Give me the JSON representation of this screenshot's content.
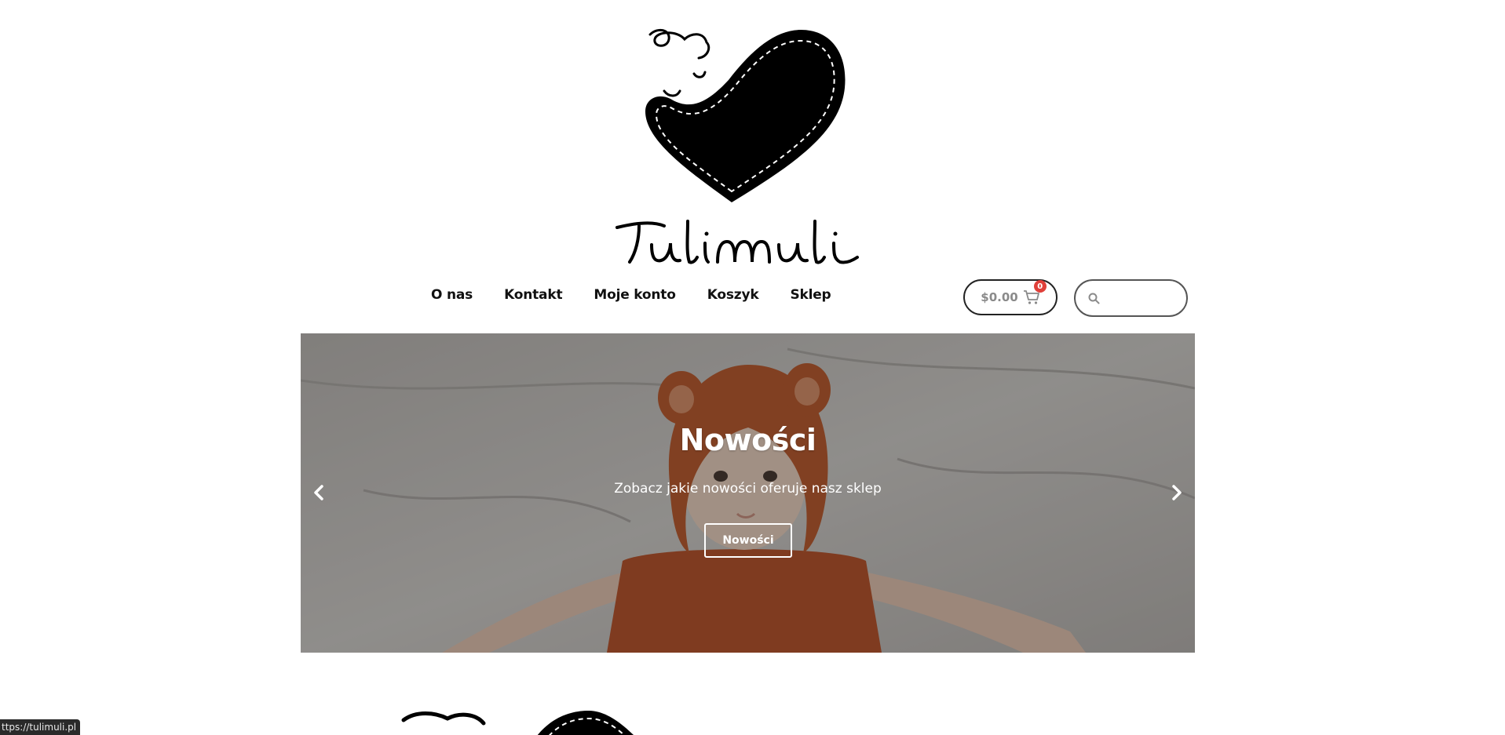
{
  "brand": {
    "name": "Tulimuli"
  },
  "nav": {
    "items": [
      {
        "label": "O nas"
      },
      {
        "label": "Kontakt"
      },
      {
        "label": "Moje konto"
      },
      {
        "label": "Koszyk"
      },
      {
        "label": "Sklep"
      }
    ]
  },
  "cart": {
    "total": "$0.00",
    "count": "0",
    "icon": "cart-icon"
  },
  "search": {
    "placeholder": "",
    "icon": "search-icon"
  },
  "slider": {
    "title": "Nowości",
    "subtitle": "Zobacz jakie nowości oferuje nasz sklep",
    "button_label": "Nowości",
    "prev_icon": "chevron-left-icon",
    "next_icon": "chevron-right-icon"
  },
  "status_bar": {
    "url": "ttps://tulimuli.pl"
  },
  "colors": {
    "badge": "#e0403a",
    "text": "#111111",
    "cart_total": "#8a8a8a"
  }
}
